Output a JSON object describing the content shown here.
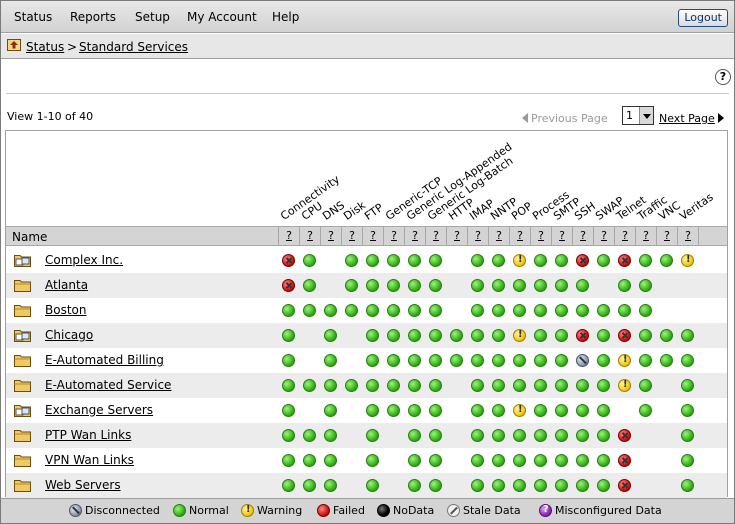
{
  "menu": {
    "items": [
      "Status",
      "Reports",
      "Setup",
      "My Account",
      "Help"
    ],
    "logout_label": "Logout"
  },
  "breadcrumb": {
    "items": [
      "Status",
      "Standard Services"
    ],
    "separator": ">"
  },
  "help_label": "?",
  "pagination": {
    "view_count": "View 1-10 of 40",
    "previous_label": "Previous Page",
    "page_value": "1",
    "next_label": "Next Page"
  },
  "table": {
    "name_header": "Name",
    "help_link": "?",
    "columns": [
      "Connectivity",
      "CPU",
      "DNS",
      "Disk",
      "FTP",
      "Generic-TCP",
      "Generic Log-Appended",
      "Generic Log-Batch",
      "HTTP",
      "IMAP",
      "NNTP",
      "POP",
      "Process",
      "SMTP",
      "SSH",
      "SWAP",
      "Telnet",
      "Traffic",
      "VNC",
      "Veritas"
    ],
    "rows": [
      {
        "name": "Complex Inc.",
        "icon": "group-icon",
        "status": [
          "f",
          "n",
          "",
          "n",
          "n",
          "n",
          "n",
          "n",
          "",
          "n",
          "n",
          "w",
          "n",
          "n",
          "f",
          "n",
          "f",
          "n",
          "n",
          "w"
        ]
      },
      {
        "name": "Atlanta",
        "icon": "folder-icon",
        "status": [
          "f",
          "n",
          "",
          "n",
          "n",
          "n",
          "n",
          "n",
          "",
          "n",
          "n",
          "n",
          "n",
          "n",
          "n",
          "",
          "n",
          "n",
          "",
          ""
        ]
      },
      {
        "name": "Boston",
        "icon": "folder-icon",
        "status": [
          "n",
          "n",
          "n",
          "n",
          "n",
          "n",
          "n",
          "n",
          "",
          "n",
          "n",
          "n",
          "n",
          "n",
          "n",
          "n",
          "n",
          "n",
          "",
          ""
        ]
      },
      {
        "name": "Chicago",
        "icon": "group-icon",
        "status": [
          "n",
          "",
          "n",
          "",
          "n",
          "n",
          "n",
          "n",
          "n",
          "n",
          "n",
          "w",
          "n",
          "n",
          "f",
          "n",
          "f",
          "n",
          "n",
          "n"
        ]
      },
      {
        "name": "E-Automated Billing",
        "icon": "folder-icon",
        "status": [
          "n",
          "",
          "n",
          "",
          "n",
          "n",
          "n",
          "n",
          "n",
          "n",
          "n",
          "n",
          "n",
          "n",
          "d",
          "n",
          "w",
          "n",
          "n",
          "n"
        ]
      },
      {
        "name": "E-Automated Service",
        "icon": "folder-icon",
        "status": [
          "n",
          "n",
          "n",
          "n",
          "n",
          "n",
          "n",
          "n",
          "",
          "n",
          "n",
          "n",
          "n",
          "n",
          "n",
          "n",
          "w",
          "n",
          "",
          "n"
        ]
      },
      {
        "name": "Exchange Servers",
        "icon": "group-icon",
        "status": [
          "n",
          "",
          "n",
          "",
          "n",
          "n",
          "n",
          "n",
          "",
          "n",
          "n",
          "w",
          "n",
          "n",
          "n",
          "n",
          "",
          "n",
          "",
          "n"
        ]
      },
      {
        "name": "PTP Wan Links",
        "icon": "folder-icon",
        "status": [
          "n",
          "n",
          "n",
          "",
          "n",
          "",
          "n",
          "n",
          "",
          "n",
          "n",
          "n",
          "n",
          "n",
          "n",
          "n",
          "f",
          "",
          "",
          "n"
        ]
      },
      {
        "name": "VPN Wan Links",
        "icon": "folder-icon",
        "status": [
          "n",
          "n",
          "n",
          "",
          "n",
          "",
          "n",
          "n",
          "",
          "n",
          "n",
          "n",
          "n",
          "n",
          "n",
          "n",
          "f",
          "",
          "",
          "n"
        ]
      },
      {
        "name": "Web Servers",
        "icon": "folder-icon",
        "status": [
          "n",
          "n",
          "n",
          "",
          "n",
          "",
          "n",
          "n",
          "",
          "n",
          "n",
          "n",
          "n",
          "n",
          "n",
          "n",
          "f",
          "",
          "",
          "n"
        ]
      }
    ]
  },
  "legend": [
    {
      "key": "d",
      "label": "Disconnected"
    },
    {
      "key": "n",
      "label": "Normal"
    },
    {
      "key": "w",
      "label": "Warning"
    },
    {
      "key": "f",
      "label": "Failed"
    },
    {
      "key": "k",
      "label": "NoData"
    },
    {
      "key": "s",
      "label": "Stale Data"
    },
    {
      "key": "m",
      "label": "Misconfigured Data"
    }
  ],
  "colors": {
    "normal": "#38b21a",
    "failed": "#d11414",
    "warning": "#f3cc17",
    "disconnected": "#8e9bb0",
    "nodata": "#000000",
    "misconfigured": "#8e2cb0"
  }
}
